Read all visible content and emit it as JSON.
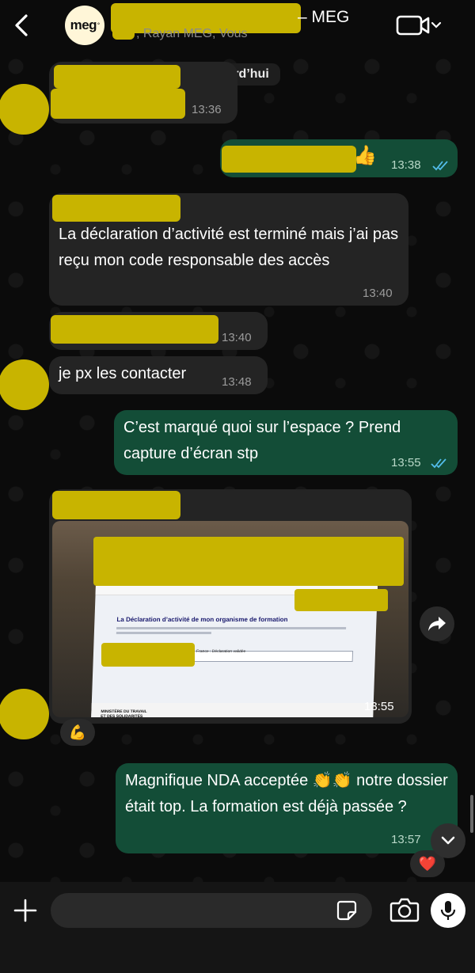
{
  "header": {
    "back_icon": "chevron-left-icon",
    "group_logo": {
      "text": "meg",
      "mark": "°"
    },
    "title_suffix": "– MEG",
    "subtitle": ", Rayan MEG, Vous",
    "video_icon": "video-camera-icon"
  },
  "chat": {
    "day_label": "Aujourd’hui",
    "messages": [
      {
        "direction": "in",
        "text": "",
        "time": "13:36",
        "redacted": true
      },
      {
        "direction": "out",
        "text": "",
        "emoji": "👍",
        "time": "13:38",
        "status": "read",
        "redacted": true
      },
      {
        "direction": "in",
        "sender_redacted": true,
        "text": "La déclaration d’activité est terminé mais j’ai pas reçu mon code responsable des accès",
        "time": "13:40"
      },
      {
        "direction": "in",
        "text": "",
        "time": "13:40",
        "redacted": true
      },
      {
        "direction": "in",
        "text": "je px les contacter",
        "time": "13:48"
      },
      {
        "direction": "out",
        "text": "C’est marqué quoi sur l’espace ? Prend capture d’écran stp",
        "time": "13:55",
        "status": "read"
      },
      {
        "direction": "in",
        "type": "image",
        "time": "13:55",
        "sender_redacted": true,
        "image_content": {
          "page_title": "La Déclaration d’activité de mon organisme de formation",
          "status_text": "France : Déclaration validée",
          "footer_logo": "MINISTÈRE DU TRAVAIL ET DES SOLIDARITÉS"
        },
        "reaction": "💪"
      },
      {
        "direction": "out",
        "text": "Magnifique NDA acceptée 👏👏 notre dossier était top. La formation est déjà passée ?",
        "time": "13:57",
        "status": "sent",
        "reaction": "❤️"
      }
    ],
    "forward_icon": "forward-arrow-icon",
    "scroll_down_icon": "chevron-down-icon"
  },
  "composer": {
    "plus_icon": "plus-icon",
    "input_value": "",
    "input_placeholder": "",
    "sticker_icon": "sticker-icon",
    "camera_icon": "camera-icon",
    "mic_icon": "microphone-icon"
  },
  "colors": {
    "background": "#0b0b0b",
    "incoming_bubble": "#242424",
    "outgoing_bubble": "#134d37",
    "read_ticks": "#53bdeb",
    "redaction": "#c8b400"
  }
}
